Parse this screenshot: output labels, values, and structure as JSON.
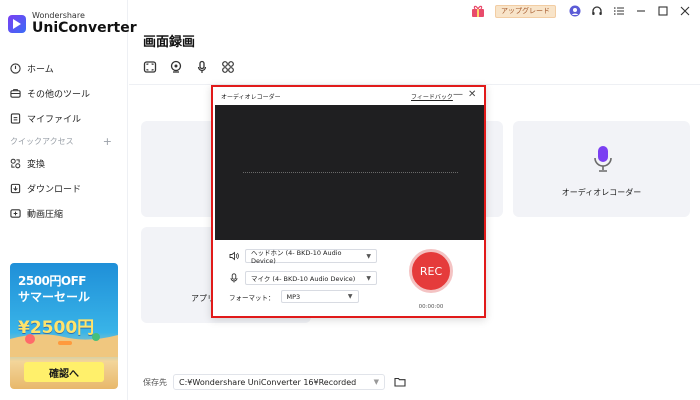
{
  "app": {
    "brand_small": "Wondershare",
    "brand_name": "UniConverter"
  },
  "topbar": {
    "upgrade_label": "アップグレード"
  },
  "sidebar": {
    "items": [
      {
        "label": "ホーム",
        "icon": "home-icon"
      },
      {
        "label": "その他のツール",
        "icon": "toolbox-icon"
      },
      {
        "label": "マイファイル",
        "icon": "file-icon"
      }
    ],
    "quick_access_label": "クイックアクセス",
    "quick_add": "+",
    "quick_items": [
      {
        "label": "変換",
        "icon": "convert-icon"
      },
      {
        "label": "ダウンロード",
        "icon": "download-icon"
      },
      {
        "label": "動画圧縮",
        "icon": "compress-icon"
      }
    ]
  },
  "promo": {
    "line1": "2500円OFF",
    "line2": "サマーセール",
    "price": "¥2500円",
    "button": "確認へ"
  },
  "main": {
    "title": "画面録画",
    "cards": {
      "audio_recorder_label": "オーディオレコーダー",
      "app_label_partial": "アプリケ"
    }
  },
  "footer": {
    "save_label": "保存先",
    "save_path": "C:¥Wondershare UniConverter 16¥Recorded"
  },
  "dialog": {
    "title": "オーディオレコーダー",
    "feedback": "フィードバック",
    "minimize": "—",
    "close": "✕",
    "speaker_device": "ヘッドホン (4- BKD-10 Audio Device)",
    "mic_device": "マイク (4- BKD-10 Audio Device)",
    "format_label": "フォーマット：",
    "format_value": "MP3",
    "rec_label": "REC",
    "timer": "00:00:00"
  },
  "colors": {
    "accent_red": "#e53b3b",
    "highlight_border": "#e11a1a",
    "mic_purple": "#7b3ff2",
    "upgrade_text": "#a4572a"
  }
}
